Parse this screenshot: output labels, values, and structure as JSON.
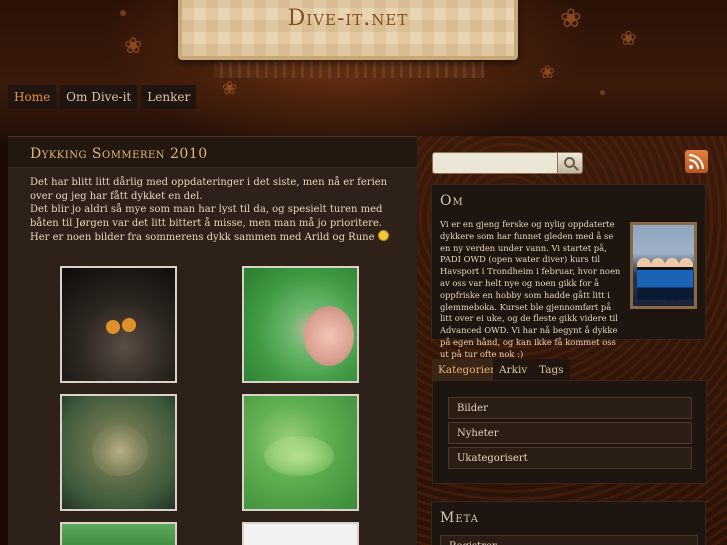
{
  "site": {
    "title": "Dive-it.net"
  },
  "nav": {
    "items": [
      {
        "label": "Home",
        "active": true
      },
      {
        "label": "Om Dive-it",
        "active": false
      },
      {
        "label": "Lenker",
        "active": false
      }
    ]
  },
  "post": {
    "title": "Dykking Sommeren 2010",
    "paragraphs": [
      "Det har blitt litt dårlig med oppdateringer i det siste, men nå er ferien over og jeg har fått dykket en del.",
      "Det blir jo aldri så mye som man har lyst til da, og spesielt turen med båten til Jørgen var det litt bittert å misse, men man må jo prioritere.",
      "Her er noen bilder fra sommerens dykk sammen med Arild og Rune"
    ]
  },
  "search": {
    "placeholder": ""
  },
  "about": {
    "title": "Om",
    "text": "Vi er en gjeng ferske og nylig oppdaterte dykkere som har funnet gleden med å se en ny verden under vann. Vi startet på, PADI OWD (open water diver) kurs til Havsport i Trondheim i februar, hvor noen av oss var helt nye og noen gikk for å oppfriske en hobby som hadde gått litt i glemmeboka. Kurset ble gjennomført på litt over ei uke, og de fleste gikk videre til Advanced OWD. Vi har nå begynt å dykke på egen hånd, og kan ikke få kommet oss ut på tur ofte nok :)"
  },
  "tabs": {
    "items": [
      {
        "label": "Kategorier",
        "active": true
      },
      {
        "label": "Arkiv",
        "active": false
      },
      {
        "label": "Tags",
        "active": false
      }
    ],
    "categories": [
      "Bilder",
      "Nyheter",
      "Ukategorisert"
    ]
  },
  "meta": {
    "title": "Meta",
    "items": [
      "Registrer"
    ]
  },
  "colors": {
    "accent": "#e8913a",
    "title": "#e2b77a",
    "panel": "#2d211a"
  }
}
